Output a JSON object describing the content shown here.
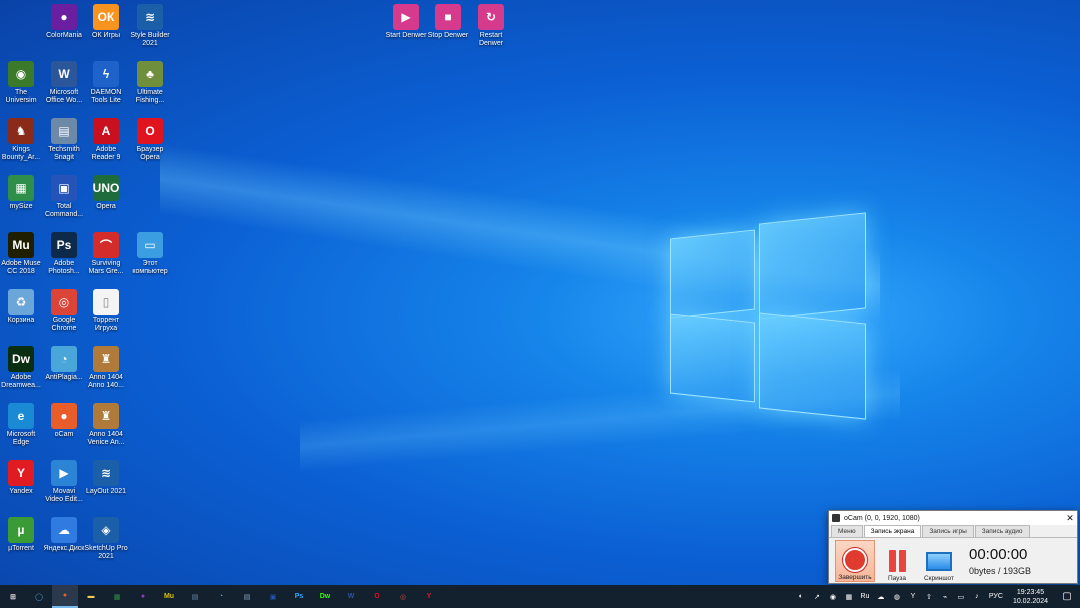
{
  "desktop": {
    "icons": [
      {
        "label": "ColorMania",
        "icon": "colormania-icon",
        "color": "#6a1fa0",
        "glyph": "●"
      },
      {
        "label": "ОК Игры",
        "icon": "ok-games-icon",
        "color": "#f7931e",
        "glyph": "ОК"
      },
      {
        "label": "Style Builder\n2021",
        "icon": "style-builder-icon",
        "color": "#1b5fa8",
        "glyph": "≋"
      },
      {
        "label": "Start Denwer",
        "icon": "start-denwer-icon",
        "color": "#d63a8c",
        "glyph": "▶"
      },
      {
        "label": "Stop Denwer",
        "icon": "stop-denwer-icon",
        "color": "#d63a8c",
        "glyph": "■"
      },
      {
        "label": "Restart\nDenwer",
        "icon": "restart-denwer-icon",
        "color": "#d63a8c",
        "glyph": "↻"
      },
      {
        "label": "The\nUniversim",
        "icon": "universim-icon",
        "color": "#3b7a2a",
        "glyph": "◉"
      },
      {
        "label": "Microsoft\nOffice Wo...",
        "icon": "word-icon",
        "color": "#2b579a",
        "glyph": "W"
      },
      {
        "label": "DAEMON\nTools Lite",
        "icon": "daemon-tools-icon",
        "color": "#1f62c9",
        "glyph": "ϟ"
      },
      {
        "label": "Ultimate\nFishing...",
        "icon": "ultimate-fishing-icon",
        "color": "#6f8f3c",
        "glyph": "♣"
      },
      {
        "label": "Kings\nBounty_Ar...",
        "icon": "kings-bounty-icon",
        "color": "#8a2b1a",
        "glyph": "♞"
      },
      {
        "label": "Techsmith\nSnagit",
        "icon": "snagit-icon",
        "color": "#6c8aa8",
        "glyph": "▤"
      },
      {
        "label": "Adobe\nReader 9",
        "icon": "adobe-reader-icon",
        "color": "#c8101e",
        "glyph": "A"
      },
      {
        "label": "Браузер\nOpera",
        "icon": "opera-icon",
        "color": "#e0141e",
        "glyph": "O"
      },
      {
        "label": "mySize",
        "icon": "mysize-icon",
        "color": "#2f8f4a",
        "glyph": "▦"
      },
      {
        "label": "Total\nCommand...",
        "icon": "total-commander-icon",
        "color": "#2454b8",
        "glyph": "▣"
      },
      {
        "label": "Opera",
        "icon": "opera-uno-icon",
        "color": "#1e6b3b",
        "glyph": "UNO"
      },
      {
        "label": "Adobe Muse\nCC 2018",
        "icon": "adobe-muse-icon",
        "color": "#1f1f00",
        "glyph": "Mu"
      },
      {
        "label": "Adobe\nPhotosh...",
        "icon": "photoshop-icon",
        "color": "#0e2a4a",
        "glyph": "Ps"
      },
      {
        "label": "Surviving\nMars Gre...",
        "icon": "surviving-mars-icon",
        "color": "#d42b2b",
        "glyph": "⌒"
      },
      {
        "label": "Этот\nкомпьютер",
        "icon": "this-pc-icon",
        "color": "#3a9ee0",
        "glyph": "▭"
      },
      {
        "label": "Корзина",
        "icon": "recycle-bin-icon",
        "color": "#6aa6d8",
        "glyph": "♻"
      },
      {
        "label": "Google\nChrome",
        "icon": "chrome-icon",
        "color": "#db4437",
        "glyph": "◎"
      },
      {
        "label": "Торрент\nИгруха",
        "icon": "torrent-file-icon",
        "color": "#f4f4f4",
        "glyph": "▯"
      },
      {
        "label": "Adobe\nDreamwea...",
        "icon": "dreamweaver-icon",
        "color": "#0a2e12",
        "glyph": "Dw"
      },
      {
        "label": "AntiPlagia...",
        "icon": "antiplagiat-icon",
        "color": "#4aa6d8",
        "glyph": "◔"
      },
      {
        "label": "Anno 1404\nAnno 140...",
        "icon": "anno-1404-icon",
        "color": "#b07a3a",
        "glyph": "♜"
      },
      {
        "label": "Microsoft\nEdge",
        "icon": "edge-icon",
        "color": "#1a8ad4",
        "glyph": "e"
      },
      {
        "label": "oCam",
        "icon": "ocam-icon",
        "color": "#e85d2a",
        "glyph": "●"
      },
      {
        "label": "Anno 1404\nVenice An...",
        "icon": "anno-venice-icon",
        "color": "#b07a3a",
        "glyph": "♜"
      },
      {
        "label": "Yandex",
        "icon": "yandex-icon",
        "color": "#e11b22",
        "glyph": "Y"
      },
      {
        "label": "Movavi\nVideo Edit...",
        "icon": "movavi-icon",
        "color": "#2b84d6",
        "glyph": "▶"
      },
      {
        "label": "LayOut 2021",
        "icon": "layout-icon",
        "color": "#1b5fa8",
        "glyph": "≋"
      },
      {
        "label": "µTorrent",
        "icon": "utorrent-icon",
        "color": "#3a9a35",
        "glyph": "µ"
      },
      {
        "label": "Яндекс.Диск",
        "icon": "yandex-disk-icon",
        "color": "#2f7be0",
        "glyph": "☁"
      },
      {
        "label": "SketchUp Pro\n2021",
        "icon": "sketchup-icon",
        "color": "#1b5fa8",
        "glyph": "◈"
      }
    ]
  },
  "ocam": {
    "title": "oCam (0, 0, 1920, 1080)",
    "close": "✕",
    "tabs": [
      "Меню",
      "Запись экрана",
      "Запись игры",
      "Запись аудио"
    ],
    "buttons": {
      "stop": "Завершить",
      "pause": "Пауза",
      "screenshot": "Скриншот"
    },
    "timer": "00:00:00",
    "size": "0bytes / 193GB"
  },
  "taskbar": {
    "apps": [
      {
        "icon": "start-icon",
        "glyph": "⊞",
        "color": "#ffffff"
      },
      {
        "icon": "search-icon",
        "glyph": "◯",
        "color": "#4aa6d8"
      },
      {
        "icon": "ocam-task-icon",
        "glyph": "●",
        "color": "#e85d2a"
      },
      {
        "icon": "explorer-icon",
        "glyph": "▬",
        "color": "#f2c94c"
      },
      {
        "icon": "mysize-task-icon",
        "glyph": "▦",
        "color": "#2f8f4a"
      },
      {
        "icon": "colormania-task-icon",
        "glyph": "●",
        "color": "#8b3fc0"
      },
      {
        "icon": "muse-task-icon",
        "glyph": "Mu",
        "color": "#d6c200"
      },
      {
        "icon": "snagit-task-icon",
        "glyph": "▤",
        "color": "#6c8aa8"
      },
      {
        "icon": "antiplagiat-task-icon",
        "glyph": "◔",
        "color": "#4aa6d8"
      },
      {
        "icon": "snagit2-task-icon",
        "glyph": "▤",
        "color": "#8aa4c0"
      },
      {
        "icon": "total-commander-task-icon",
        "glyph": "▣",
        "color": "#2454b8"
      },
      {
        "icon": "photoshop-task-icon",
        "glyph": "Ps",
        "color": "#31a8ff"
      },
      {
        "icon": "dreamweaver-task-icon",
        "glyph": "Dw",
        "color": "#35fa00"
      },
      {
        "icon": "word-task-icon",
        "glyph": "W",
        "color": "#2b579a"
      },
      {
        "icon": "opera-task-icon",
        "glyph": "O",
        "color": "#e0141e"
      },
      {
        "icon": "chrome-task-icon",
        "glyph": "◎",
        "color": "#db4437"
      },
      {
        "icon": "yandex-task-icon",
        "glyph": "Y",
        "color": "#e11b22"
      }
    ],
    "tray": {
      "icons": [
        "ok-tray-icon",
        "speed-tray-icon",
        "record-tray-icon",
        "network-tray-icon",
        "ru-tray-icon",
        "cloud-tray-icon",
        "antivirus-tray-icon",
        "yandex-tray-icon",
        "upload-tray-icon",
        "usb-tray-icon",
        "monitor-tray-icon",
        "volume-tray-icon"
      ],
      "language": "РУС",
      "time": "19:23:45",
      "date": "10.02.2024"
    }
  }
}
